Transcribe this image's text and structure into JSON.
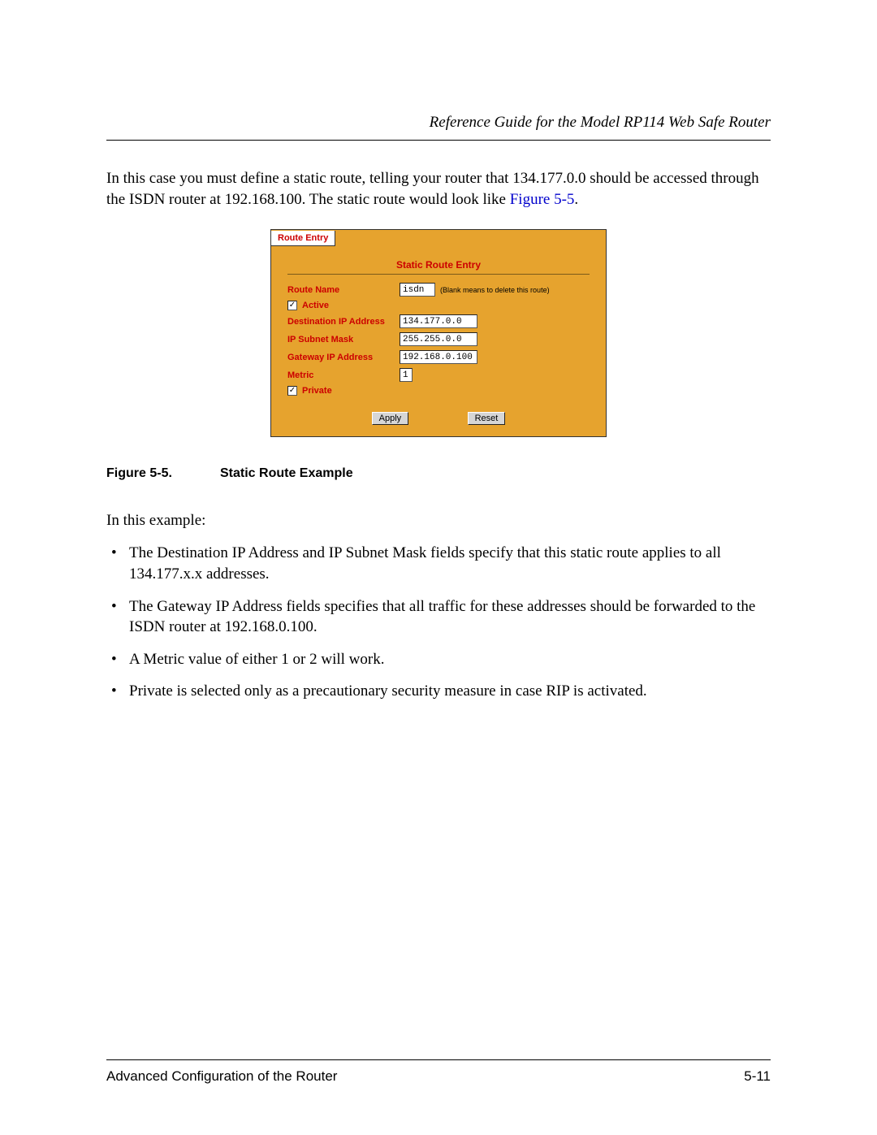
{
  "header": {
    "title": "Reference Guide for the Model RP114 Web Safe Router"
  },
  "intro": {
    "text_before_link": "In this case you must define a static route, telling your router that 134.177.0.0 should be accessed through the ISDN router at 192.168.100. The static route would look like ",
    "link_text": "Figure 5-5",
    "text_after_link": "."
  },
  "panel": {
    "tab": "Route Entry",
    "heading": "Static Route Entry",
    "fields": {
      "route_name_label": "Route Name",
      "route_name_value": "isdn",
      "route_name_hint": "(Blank means to delete this route)",
      "active_label": "Active",
      "active_checked": "✓",
      "dest_ip_label": "Destination IP Address",
      "dest_ip_value": "134.177.0.0",
      "subnet_label": "IP Subnet Mask",
      "subnet_value": "255.255.0.0",
      "gateway_label": "Gateway IP Address",
      "gateway_value": "192.168.0.100",
      "metric_label": "Metric",
      "metric_value": "1",
      "private_label": "Private",
      "private_checked": "✓"
    },
    "buttons": {
      "apply": "Apply",
      "reset": "Reset"
    }
  },
  "caption": {
    "number": "Figure 5-5.",
    "text": "Static Route Example"
  },
  "example": {
    "intro": "In this example:",
    "bullets": [
      "The Destination IP Address and IP Subnet Mask fields specify that this static route applies to all 134.177.x.x addresses.",
      "The Gateway IP Address fields specifies that all traffic for these addresses should be forwarded to the ISDN router at 192.168.0.100.",
      "A Metric value of either 1 or 2 will work.",
      "Private is selected only as a precautionary security measure in case RIP is activated."
    ]
  },
  "footer": {
    "left": "Advanced Configuration of the Router",
    "right": "5-11"
  }
}
